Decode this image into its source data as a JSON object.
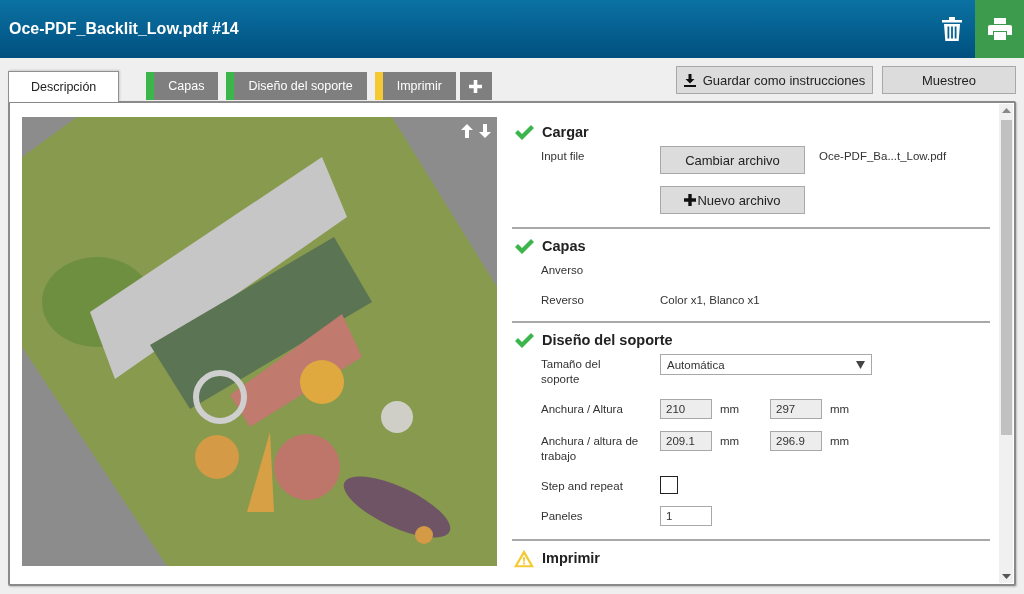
{
  "window": {
    "title": "Oce-PDF_Backlit_Low.pdf #14"
  },
  "tabs": [
    {
      "label": "Descripción",
      "selected": true
    },
    {
      "label": "Capas",
      "selected": false,
      "color": "#3cb54a"
    },
    {
      "label": "Diseño del soporte",
      "selected": false,
      "color": "#3cb54a"
    },
    {
      "label": "Imprimir",
      "selected": false,
      "color": "#f5c932"
    }
  ],
  "toolbar": {
    "buttons": [
      "Guardar como instrucciones",
      "Muestreo"
    ]
  },
  "sections": [
    {
      "title": "Cargar",
      "kind": "ok",
      "rows": [
        {
          "kind": "file",
          "label": "Input file",
          "button": "Cambiar archivo",
          "value": "Oce-PDF_Ba...t_Low.pdf"
        },
        {
          "kind": "button",
          "button": "Nuevo archivo"
        }
      ]
    },
    {
      "title": "Capas",
      "kind": "ok",
      "rows": [
        {
          "kind": "text",
          "label": "Anverso"
        },
        {
          "kind": "text",
          "label": "Reverso",
          "value": "Color x1, Blanco x1"
        }
      ]
    },
    {
      "title": "Diseño del soporte",
      "kind": "ok",
      "rows": [
        {
          "kind": "select",
          "label": "Tamaño del soporte",
          "value": "Automática"
        },
        {
          "kind": "pair",
          "label": "Anchura / Altura",
          "fields": [
            {
              "value": "210",
              "unit": "mm",
              "disabled": true
            },
            {
              "value": "297",
              "unit": "mm",
              "disabled": true
            }
          ]
        },
        {
          "kind": "pair",
          "label": "Anchura / altura de trabajo",
          "fields": [
            {
              "value": "209.1",
              "unit": "mm",
              "disabled": true
            },
            {
              "value": "296.9",
              "unit": "mm",
              "disabled": true
            }
          ]
        },
        {
          "kind": "checkbox",
          "label": "Step and repeat",
          "checked": false
        },
        {
          "kind": "input",
          "label": "Paneles",
          "value": "1"
        }
      ]
    },
    {
      "title": "Imprimir",
      "kind": "warning"
    }
  ]
}
